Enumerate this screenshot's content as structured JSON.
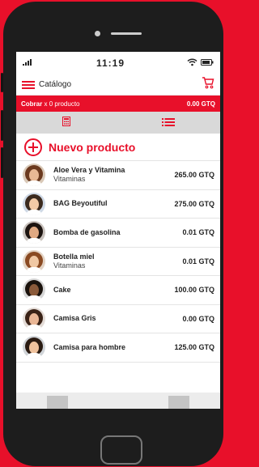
{
  "status": {
    "time": "11:19"
  },
  "nav": {
    "title": "Catálogo"
  },
  "cobrar": {
    "label": "Cobrar",
    "count": "x 0 producto",
    "total": "0.00 GTQ"
  },
  "new_product": {
    "label": "Nuevo producto"
  },
  "products": [
    {
      "name": "Aloe Vera y Vitamina",
      "category": "Vitaminas",
      "price": "265.00 GTQ",
      "hair": "#6b3a1f",
      "skin": "#e8b894",
      "bg": "#d9c9b8"
    },
    {
      "name": "BAG Beyoutiful",
      "category": "",
      "price": "275.00 GTQ",
      "hair": "#3b2a1e",
      "skin": "#f1c9a6",
      "bg": "#cfd9e6"
    },
    {
      "name": "Bomba de gasolina",
      "category": "",
      "price": "0.01 GTQ",
      "hair": "#1c1410",
      "skin": "#e0a982",
      "bg": "#c9c2bd"
    },
    {
      "name": "Botella miel",
      "category": "Vitaminas",
      "price": "0.01 GTQ",
      "hair": "#8a4a22",
      "skin": "#f0c8a4",
      "bg": "#e3d3c4"
    },
    {
      "name": "Cake",
      "category": "",
      "price": "100.00 GTQ",
      "hair": "#1a120c",
      "skin": "#8a5a3a",
      "bg": "#d6d6d6"
    },
    {
      "name": "Camisa Gris",
      "category": "",
      "price": "0.00 GTQ",
      "hair": "#3a2216",
      "skin": "#eab796",
      "bg": "#e3dbd6"
    },
    {
      "name": "Camisa para hombre",
      "category": "",
      "price": "125.00 GTQ",
      "hair": "#2a1b12",
      "skin": "#efc29d",
      "bg": "#d0d4d8"
    }
  ],
  "colors": {
    "accent": "#e8102a",
    "phone": "#1d1d1d"
  }
}
